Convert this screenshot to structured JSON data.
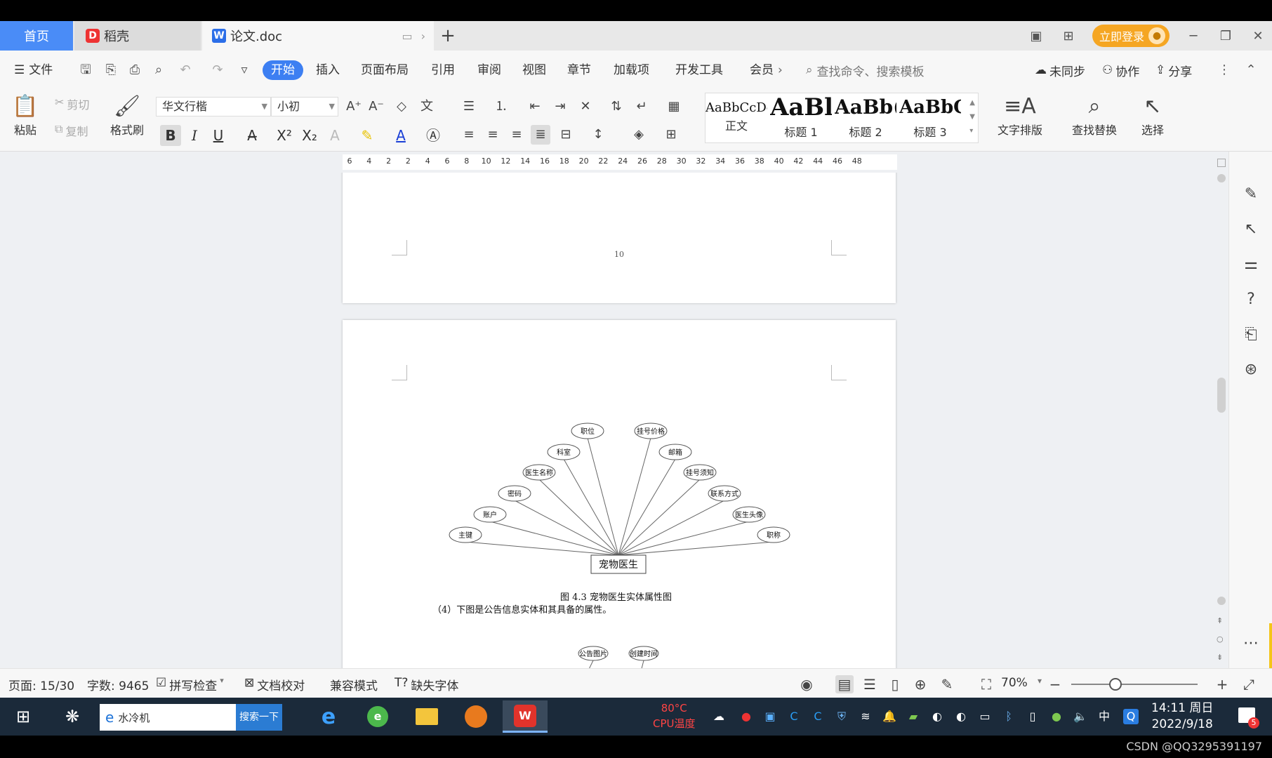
{
  "tabs": {
    "home": "首页",
    "daoke": "稻壳",
    "doc": "论文.doc",
    "login": "立即登录"
  },
  "menu": {
    "file": "文件",
    "items": [
      "开始",
      "插入",
      "页面布局",
      "引用",
      "审阅",
      "视图",
      "章节",
      "加载项",
      "开发工具",
      "会员"
    ],
    "search_placeholder": "查找命令、搜索模板",
    "sync": "未同步",
    "collab": "协作",
    "share": "分享"
  },
  "ribbon": {
    "paste": "粘贴",
    "cut": "剪切",
    "copy": "复制",
    "format_painter": "格式刷",
    "font_name": "华文行楷",
    "font_size": "小初",
    "bold": "B",
    "italic": "I",
    "underline": "U",
    "styles": [
      {
        "preview": "AaBbCcDd",
        "label": "正文"
      },
      {
        "preview": "AaBl",
        "label": "标题 1"
      },
      {
        "preview": "AaBb(",
        "label": "标题 2"
      },
      {
        "preview": "AaBbC",
        "label": "标题 3"
      }
    ],
    "text_layout": "文字排版",
    "find_replace": "查找替换",
    "select": "选择"
  },
  "ruler": {
    "ticks": [
      "6",
      "4",
      "2",
      "2",
      "4",
      "6",
      "8",
      "10",
      "12",
      "14",
      "16",
      "18",
      "20",
      "22",
      "24",
      "26",
      "28",
      "30",
      "32",
      "34",
      "36",
      "38",
      "40",
      "42",
      "44",
      "46",
      "48"
    ]
  },
  "document": {
    "page_number": "10",
    "entity": "宠物医生",
    "attributes_left": [
      "主键",
      "账户",
      "密码",
      "医生名称",
      "科室",
      "职位"
    ],
    "attributes_right": [
      "挂号价格",
      "邮箱",
      "挂号须知",
      "联系方式",
      "医生头像",
      "职称"
    ],
    "figure_caption": "图 4.3 宠物医生实体属性图",
    "paragraph": "（4）下图是公告信息实体和其具备的属性。",
    "next_attributes": [
      "公告图片",
      "创建时间"
    ]
  },
  "status": {
    "page": "页面: 15/30",
    "words": "字数: 9465",
    "spell": "拼写检查",
    "proofread": "文档校对",
    "compat": "兼容模式",
    "missing_font": "缺失字体",
    "zoom": "70%"
  },
  "taskbar": {
    "search_text": "水冷机",
    "search_button": "搜索一下",
    "cpu_temp": "80°C",
    "cpu_label": "CPU温度",
    "ime": "中",
    "time": "14:11 周日",
    "date": "2022/9/18",
    "notif_count": "5"
  },
  "watermark": "CSDN @QQ3295391197",
  "colors": {
    "accent": "#3d7ff2",
    "tab_home": "#4a8cf7",
    "login": "#f5a623",
    "taskbar": "#1b2a3a"
  }
}
